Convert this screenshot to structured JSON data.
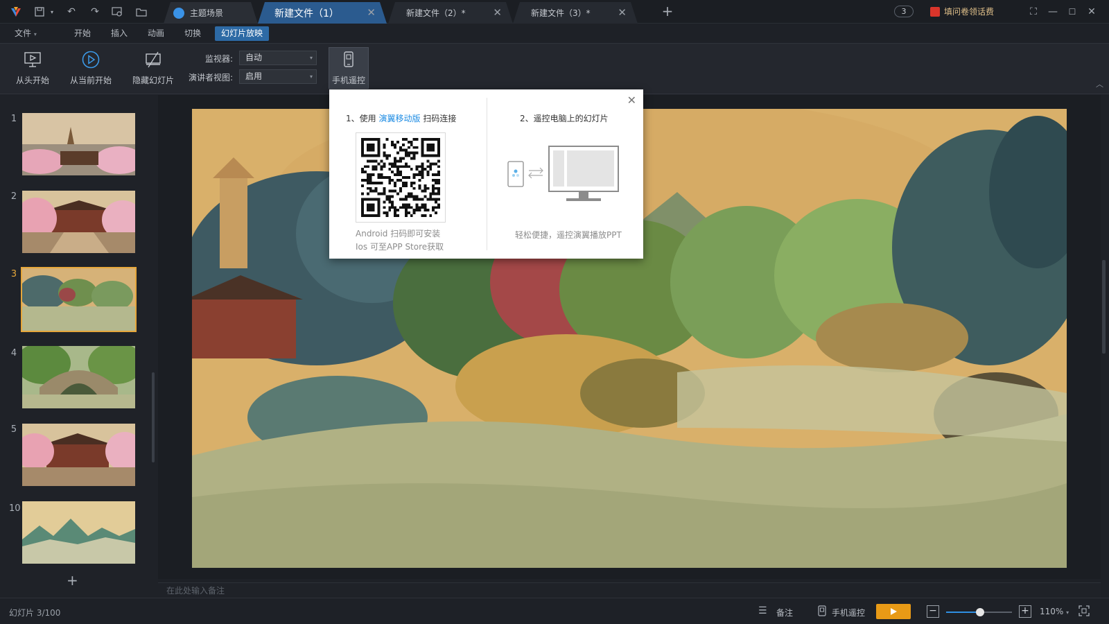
{
  "titlebar": {
    "tabs": [
      {
        "label": "主题场景"
      },
      {
        "label": "新建文件（1）"
      },
      {
        "label": "新建文件（2）*"
      },
      {
        "label": "新建文件（3）*"
      }
    ],
    "notification_count": "3",
    "survey_label": "填问卷领话费"
  },
  "menu": {
    "items": [
      "文件",
      "开始",
      "插入",
      "动画",
      "切换",
      "幻灯片放映"
    ],
    "active": "幻灯片放映"
  },
  "ribbon": {
    "from_start": "从头开始",
    "from_current": "从当前开始",
    "hide_slide": "隐藏幻灯片",
    "monitor_label": "监视器:",
    "monitor_value": "自动",
    "presenter_label": "演讲者视图:",
    "presenter_value": "启用",
    "phone_remote": "手机遥控"
  },
  "slides": {
    "numbers": [
      "1",
      "2",
      "3",
      "4",
      "5",
      "10"
    ],
    "current": "3",
    "add_icon": "plus-icon"
  },
  "notes_placeholder": "在此处输入备注",
  "popup": {
    "step1_prefix": "1、使用",
    "step1_link": "演翼移动版",
    "step1_suffix": "扫码连接",
    "step2": "2、遥控电脑上的幻灯片",
    "android_note": "Android 扫码即可安装",
    "ios_note": "Ios 可至APP Store获取",
    "remote_note": "轻松便捷，遥控演翼播放PPT"
  },
  "status": {
    "slide_counter": "幻灯片 3/100",
    "notes_label": "备注",
    "remote_label": "手机遥控",
    "zoom": "110%",
    "zoom_fraction": 0.52
  },
  "colors": {
    "accent_blue": "#2d6aa5",
    "active_tab": "#2b5b8f",
    "current_slide": "#e6a73b",
    "play_button": "#e89a16",
    "link_blue": "#1e8ce3"
  }
}
